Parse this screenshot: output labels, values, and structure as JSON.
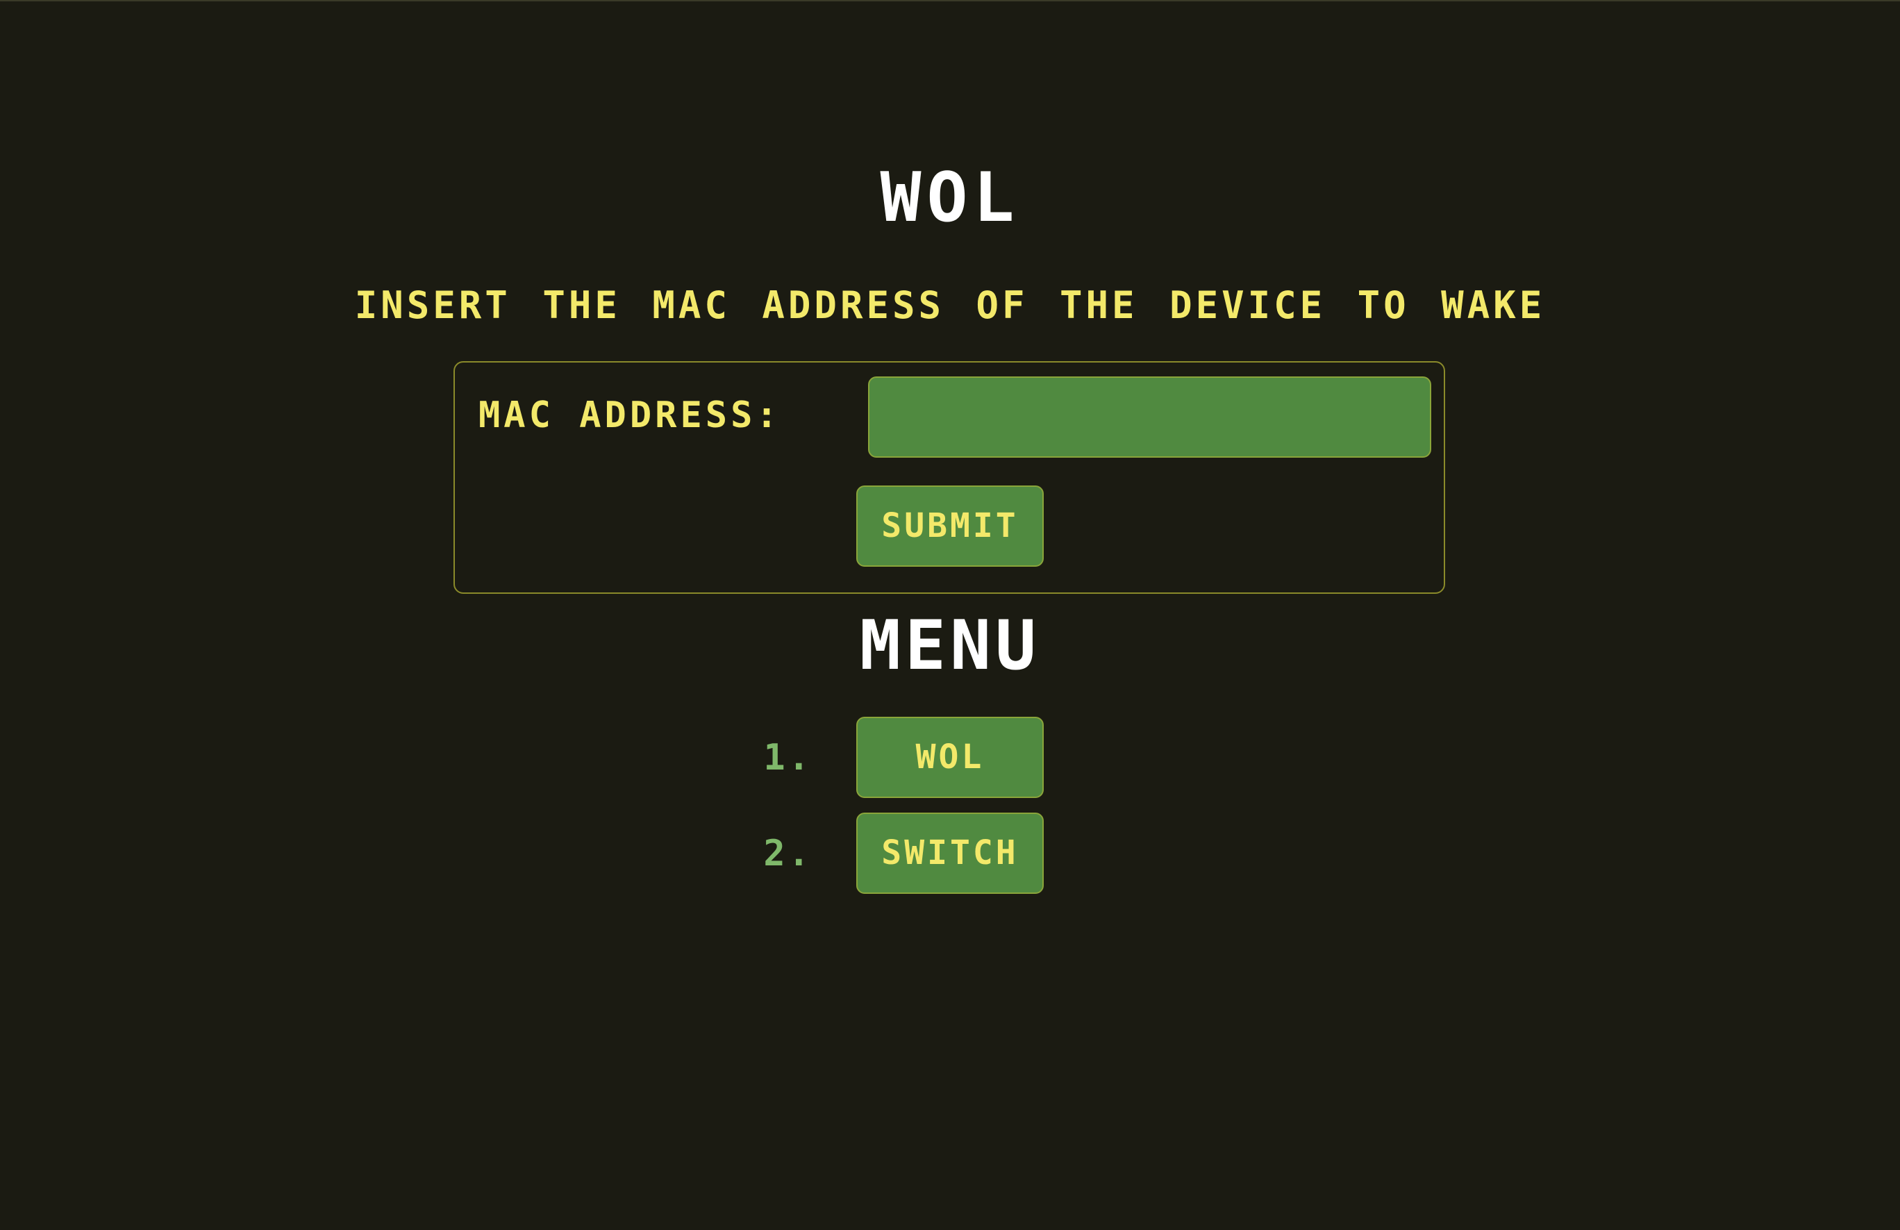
{
  "page": {
    "title": "WOL",
    "subtitle": "INSERT THE MAC ADDRESS OF THE DEVICE TO WAKE"
  },
  "form": {
    "mac_label": "MAC ADDRESS:",
    "mac_value": "",
    "submit_label": "SUBMIT"
  },
  "menu": {
    "title": "MENU",
    "items": [
      {
        "number": "1.",
        "label": "WOL"
      },
      {
        "number": "2.",
        "label": "SWITCH"
      }
    ]
  },
  "colors": {
    "background": "#1b1b12",
    "accent_yellow": "#f3e96a",
    "button_green": "#508a40",
    "number_green": "#7fb86a",
    "title_white": "#ffffff"
  }
}
